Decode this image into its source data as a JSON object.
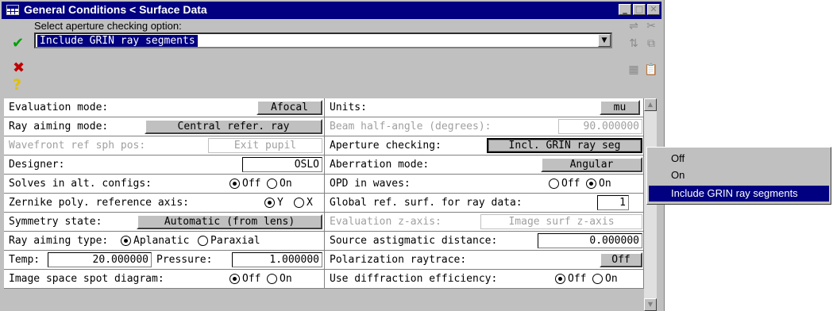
{
  "window": {
    "title": "General Conditions < Surface Data"
  },
  "header": {
    "prompt": "Select aperture checking option:",
    "combo_value": "Include GRIN ray segments"
  },
  "icons": {
    "accept": "check-icon",
    "cancel": "x-icon",
    "help": "question-icon",
    "toolbar": [
      "insert-row-icon",
      "cut-icon",
      "sort-icon",
      "copy-icon",
      "grid-icon",
      "paste-icon"
    ]
  },
  "rows": [
    {
      "left": {
        "label": "Evaluation mode:",
        "value": "Afocal"
      },
      "right": {
        "label": "Units:",
        "value": "mu"
      }
    },
    {
      "left": {
        "label": "Ray aiming mode:",
        "value": "Central refer. ray"
      },
      "right": {
        "label": "Beam half-angle (degrees):",
        "value": "90.000000"
      }
    },
    {
      "left": {
        "label": "Wavefront ref sph pos:",
        "value": "Exit pupil"
      },
      "right": {
        "label": "Aperture checking:",
        "value": "Incl. GRIN ray seg"
      }
    },
    {
      "left": {
        "label": "Designer:",
        "value": "OSLO"
      },
      "right": {
        "label": "Aberration mode:",
        "value": "Angular"
      }
    },
    {
      "left": {
        "label": "Solves in alt. configs:",
        "opt1": "Off",
        "opt2": "On"
      },
      "right": {
        "label": "OPD in waves:",
        "opt1": "Off",
        "opt2": "On"
      }
    },
    {
      "left": {
        "label": "Zernike poly. reference axis:",
        "opt1": "Y",
        "opt2": "X"
      },
      "right": {
        "label": "Global ref. surf. for ray data:",
        "value": "1"
      }
    },
    {
      "left": {
        "label": "Symmetry state:",
        "value": "Automatic (from lens)"
      },
      "right": {
        "label": "Evaluation z-axis:",
        "value": "Image surf z-axis"
      }
    },
    {
      "left": {
        "label": "Ray aiming type:",
        "opt1": "Aplanatic",
        "opt2": "Paraxial"
      },
      "right": {
        "label": "Source astigmatic distance:",
        "value": "0.000000"
      }
    },
    {
      "left": {
        "label": "Temp:",
        "value": "20.000000",
        "label2": "Pressure:",
        "value2": "1.000000"
      },
      "right": {
        "label": "Polarization raytrace:",
        "value": "Off"
      }
    },
    {
      "left": {
        "label": "Image space spot diagram:",
        "opt1": "Off",
        "opt2": "On"
      },
      "right": {
        "label": "Use diffraction efficiency:",
        "opt1": "Off",
        "opt2": "On"
      }
    }
  ],
  "dropdown_menu": {
    "items": [
      "Off",
      "On",
      "Include GRIN ray segments"
    ],
    "selected": "Include GRIN ray segments"
  },
  "colors": {
    "title_bar": "#000080",
    "selection": "#000080",
    "dialog": "#c0c0c0"
  }
}
